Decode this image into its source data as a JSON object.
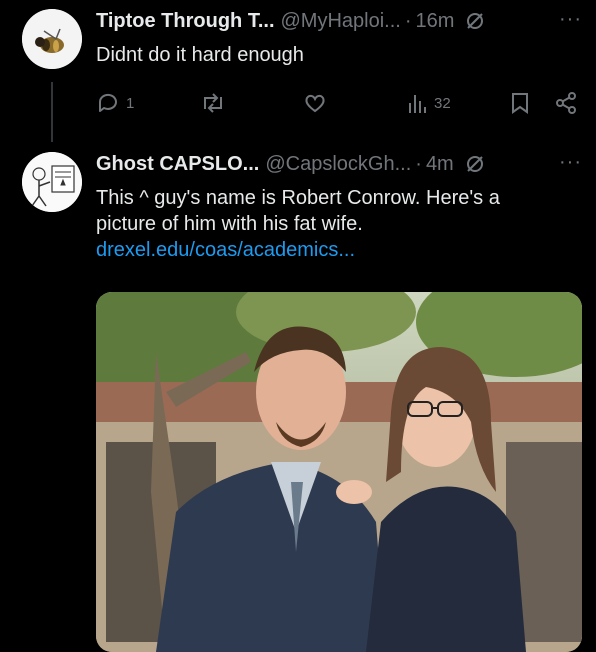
{
  "tweets": [
    {
      "name": "Tiptoe Through T...",
      "handle": "@MyHaploi...",
      "time": "16m",
      "text": "Didnt do it hard enough",
      "reply_count": "1",
      "view_count": "32",
      "icons": [
        "bee-avatar-icon",
        "no-edit-icon",
        "more-icon",
        "reply-icon",
        "retweet-icon",
        "like-icon",
        "views-icon",
        "bookmark-icon",
        "share-icon"
      ]
    },
    {
      "name": "Ghost CAPSLO...",
      "handle": "@CapslockGh...",
      "time": "4m",
      "text_line1": "This ^ guy's name is Robert Conrow. Here's a",
      "text_line2": "picture of him with his fat wife.",
      "link": "drexel.edu/coas/academics..."
    }
  ],
  "separator": "·",
  "more_glyph": "···",
  "colors": {
    "accent": "#1d9bf0",
    "muted": "#71767b",
    "text": "#e7e9ea"
  }
}
